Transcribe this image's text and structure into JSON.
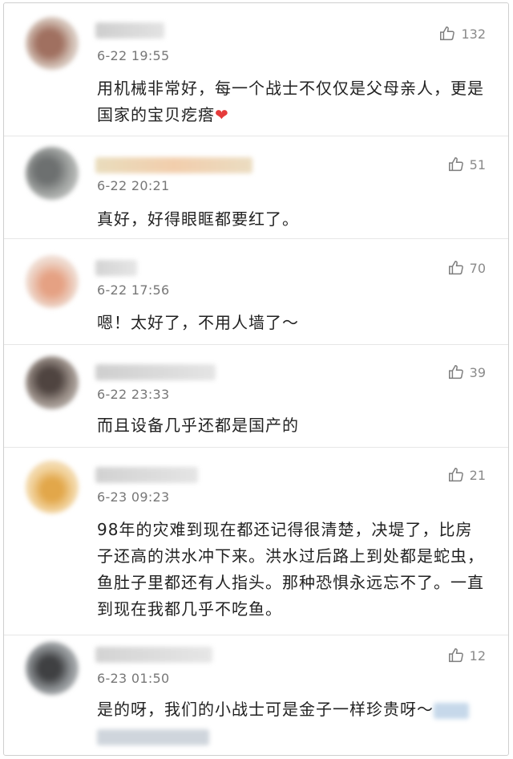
{
  "comments": [
    {
      "time": "6-22 19:55",
      "likes": "132",
      "text": "用机械非常好，每一个战士不仅仅是父母亲人，更是国家的宝贝疙瘩",
      "emoji": "❤"
    },
    {
      "time": "6-22 20:21",
      "likes": "51",
      "text": "真好，好得眼眶都要红了。"
    },
    {
      "time": "6-22 17:56",
      "likes": "70",
      "text": "嗯！太好了，不用人墙了～"
    },
    {
      "time": "6-22 23:33",
      "likes": "39",
      "text": "而且设备几乎还都是国产的"
    },
    {
      "time": "6-23 09:23",
      "likes": "21",
      "text": "98年的灾难到现在都还记得很清楚，决堤了，比房子还高的洪水冲下来。洪水过后路上到处都是蛇虫，鱼肚子里都还有人指头。那种恐惧永远忘不了。一直到现在我都几乎不吃鱼。"
    },
    {
      "time": "6-23 01:50",
      "likes": "12",
      "text": "是的呀，我们的小战士可是金子一样珍贵呀～"
    }
  ],
  "icons": {
    "like": "thumbs-up-icon"
  },
  "colors": {
    "heart": "#e53b3b",
    "meta": "#777777"
  }
}
